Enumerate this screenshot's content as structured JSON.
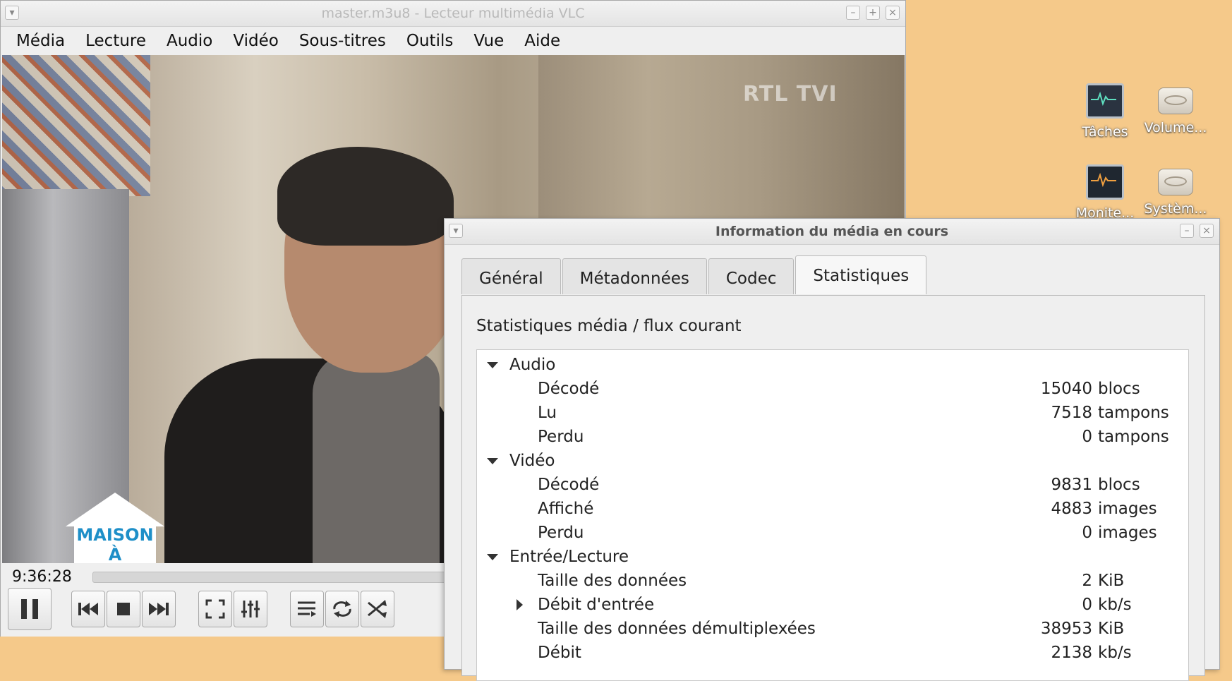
{
  "desktop": {
    "icons": [
      {
        "label": "Tâches",
        "icon": "system-monitor-icon"
      },
      {
        "label": "Volume...",
        "icon": "drive-icon"
      },
      {
        "label": "Monite...",
        "icon": "system-monitor-icon"
      },
      {
        "label": "Systèm...",
        "icon": "drive-icon"
      }
    ]
  },
  "vlc": {
    "title": "master.m3u8 - Lecteur multimédia VLC",
    "menu": [
      {
        "label": "Média"
      },
      {
        "label": "Lecture"
      },
      {
        "label": "Audio"
      },
      {
        "label": "Vidéo"
      },
      {
        "label": "Sous-titres"
      },
      {
        "label": "Outils"
      },
      {
        "label": "Vue"
      },
      {
        "label": "Aide"
      }
    ],
    "video": {
      "watermark": "RTL TVI",
      "sign_line1": "MAISON",
      "sign_line2": "À VENDRE"
    },
    "time": "9:36:28"
  },
  "dialog": {
    "title": "Information du média en cours",
    "tabs": [
      {
        "label": "Général"
      },
      {
        "label": "Métadonnées"
      },
      {
        "label": "Codec"
      },
      {
        "label": "Statistiques",
        "active": true
      }
    ],
    "heading": "Statistiques média / flux courant",
    "sections": {
      "audio": {
        "label": "Audio",
        "rows": [
          {
            "name": "Décodé",
            "value": "15040",
            "unit": "blocs"
          },
          {
            "name": "Lu",
            "value": "7518",
            "unit": "tampons"
          },
          {
            "name": "Perdu",
            "value": "0",
            "unit": "tampons"
          }
        ]
      },
      "video": {
        "label": "Vidéo",
        "rows": [
          {
            "name": "Décodé",
            "value": "9831",
            "unit": "blocs"
          },
          {
            "name": "Affiché",
            "value": "4883",
            "unit": "images"
          },
          {
            "name": "Perdu",
            "value": "0",
            "unit": "images"
          }
        ]
      },
      "input": {
        "label": "Entrée/Lecture",
        "rows": [
          {
            "name": "Taille des données",
            "value": "2",
            "unit": "KiB"
          },
          {
            "name": "Débit d'entrée",
            "value": "0",
            "unit": "kb/s"
          },
          {
            "name": "Taille des données démultiplexées",
            "value": "38953",
            "unit": "KiB"
          },
          {
            "name": "Débit",
            "value": "2138",
            "unit": "kb/s"
          }
        ]
      }
    }
  }
}
